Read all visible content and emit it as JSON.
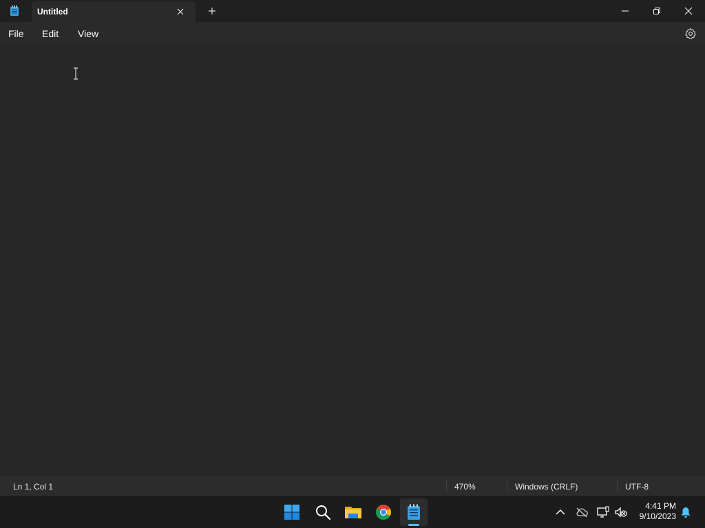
{
  "window": {
    "tab_title": "Untitled"
  },
  "menu": {
    "file": "File",
    "edit": "Edit",
    "view": "View"
  },
  "editor": {
    "content": ""
  },
  "status": {
    "position": "Ln 1, Col 1",
    "zoom": "470%",
    "line_endings": "Windows (CRLF)",
    "encoding": "UTF-8"
  },
  "taskbar": {
    "apps": [
      "start-icon",
      "search-icon",
      "file-explorer-icon",
      "chrome-icon",
      "notepad-icon"
    ],
    "time": "4:41 PM",
    "date": "9/10/2023"
  },
  "colors": {
    "accent": "#4cc2ff",
    "window_bg": "#202020",
    "editor_bg": "#272727"
  }
}
